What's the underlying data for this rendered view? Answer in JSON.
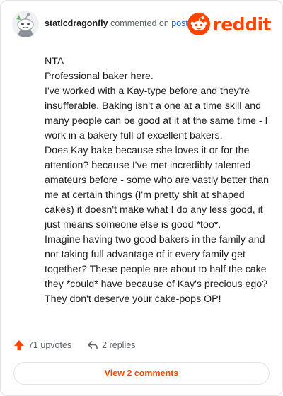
{
  "header": {
    "username": "staticdragonfly",
    "action_text": "commented on",
    "post_link": "post",
    "logo_text": "reddit"
  },
  "comment": {
    "lines": [
      "NTA",
      "Professional baker here.",
      "I've worked with a Kay-type before and they're insufferable. Baking isn't a one at a time skill and many people can be good at it at the same time - I work in a bakery full of excellent bakers.",
      "Does Kay bake because she loves it or for the attention? because I've met incredibly talented amateurs before - some who are vastly better than me at certain things (I'm pretty shit at shaped cakes) it doesn't make what I do any less good, it just means someone else is good *too*.",
      "Imagine having two good bakers in the family and not taking full advantage of it every family get together? These people are about to half the cake they *could* have because of Kay's precious ego? They don't deserve your cake-pops OP!"
    ]
  },
  "actions": {
    "upvotes": "71 upvotes",
    "replies": "2 replies"
  },
  "view_comments": "View 2 comments",
  "colors": {
    "brand": "#ff4500",
    "link": "#0f5fd6",
    "text": "#1c1c1c",
    "muted": "#5c6166"
  }
}
